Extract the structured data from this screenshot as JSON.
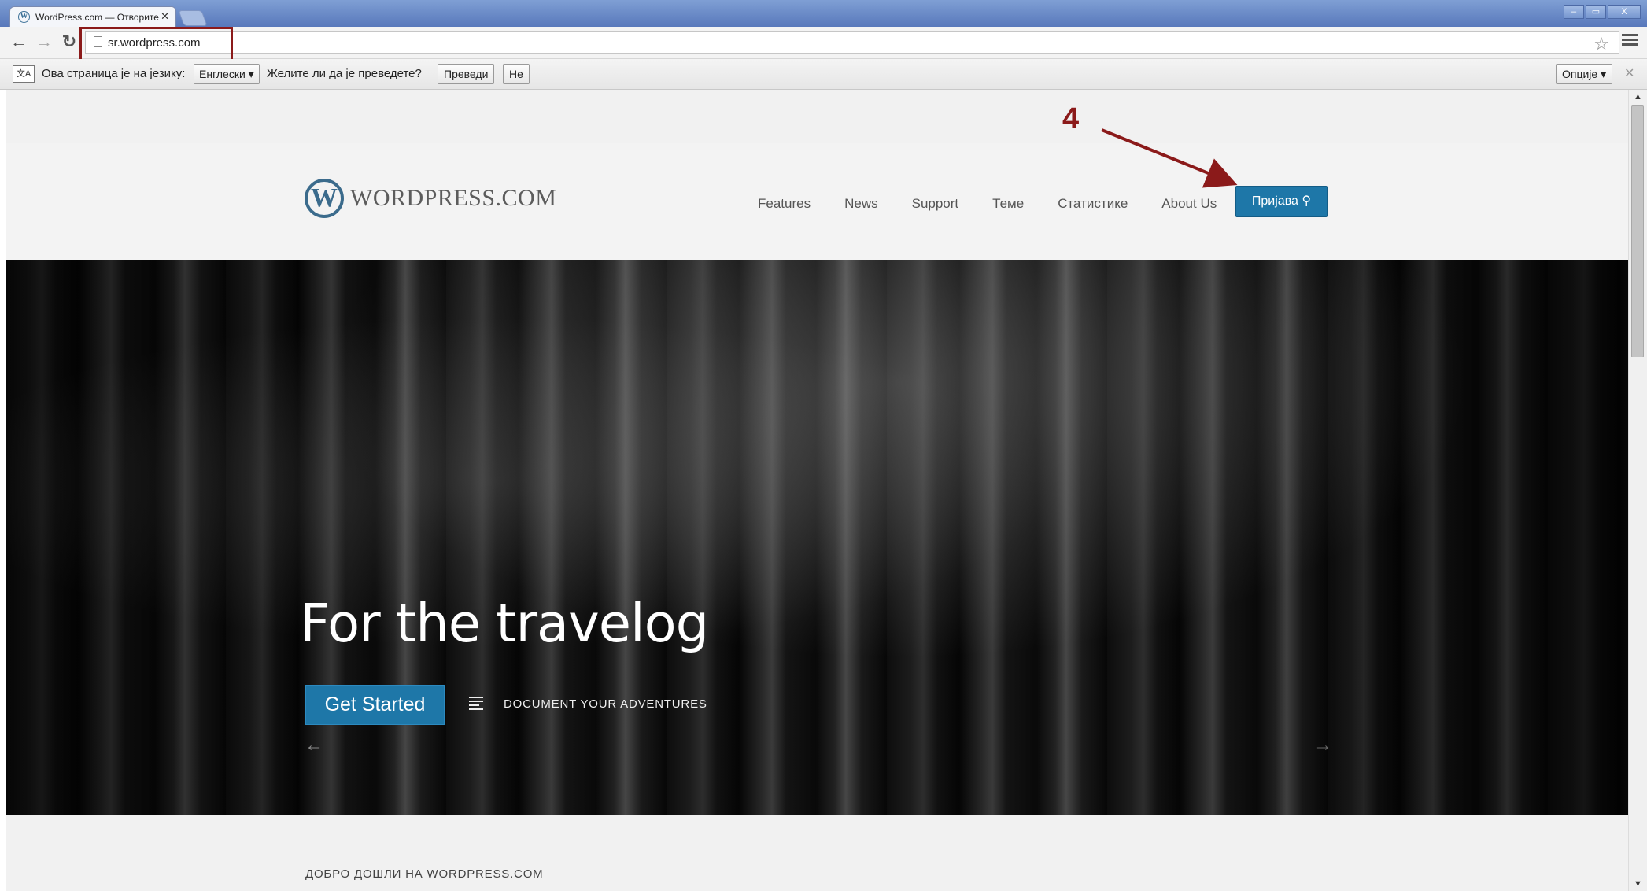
{
  "browser": {
    "tab_title": "WordPress.com — Отворите",
    "tab_close": "✕",
    "url": "sr.wordpress.com",
    "window_buttons": [
      "–",
      "▭",
      "X"
    ]
  },
  "translate_bar": {
    "prompt": "Ова страница је на језику:",
    "language": "Енглески ▾",
    "question": "Желите ли да је преведете?",
    "translate_button": "Преведи",
    "no_button": "Не",
    "options_button": "Опције ▾",
    "close": "✕"
  },
  "site": {
    "logo_text": "WORDPRESS.COM",
    "logo_mark": "W",
    "nav": [
      "Features",
      "News",
      "Support",
      "Теме",
      "Статистике",
      "About Us"
    ],
    "login_button": "Пријава ⚲"
  },
  "hero": {
    "title": "For the travelog",
    "cta": "Get Started",
    "secondary_link": "DOCUMENT YOUR ADVENTURES",
    "prev": "←",
    "next": "→"
  },
  "welcome": "ДОБРО ДОШЛИ НА WORDPRESS.COM",
  "annotation": {
    "label": "4",
    "color": "#8b1a1a"
  },
  "colors": {
    "accent": "#1e77a8",
    "annotation": "#8b1a1a"
  }
}
